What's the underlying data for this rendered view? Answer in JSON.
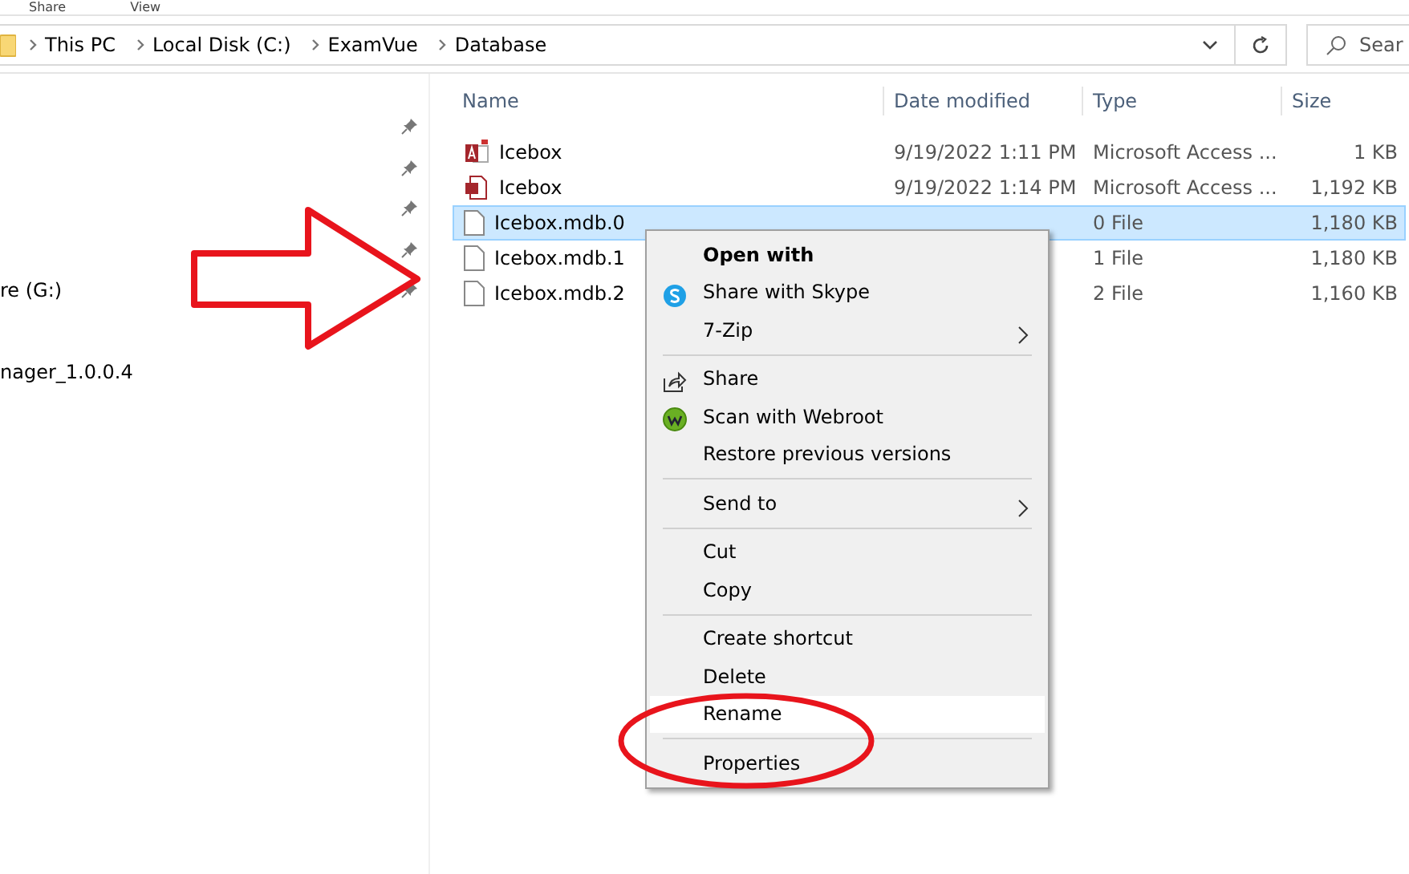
{
  "ribbon_tabs": [
    {
      "label": "Share"
    },
    {
      "label": "View"
    }
  ],
  "address_bar": {
    "breadcrumbs": [
      "This PC",
      "Local Disk (C:)",
      "ExamVue",
      "Database"
    ]
  },
  "search": {
    "placeholder": "Sear"
  },
  "sidebar": {
    "items": [
      {
        "pinned": true
      },
      {
        "pinned": true
      },
      {
        "pinned": true
      },
      {
        "pinned": true
      },
      {
        "label": "re (G:)",
        "pinned": true
      },
      {
        "label": "nager_1.0.0.4",
        "pinned": false
      }
    ]
  },
  "table": {
    "columns": [
      "Name",
      "Date modified",
      "Type",
      "Size"
    ],
    "rows": [
      {
        "kind": "access",
        "name": "Icebox",
        "date": "9/19/2022 1:11 PM",
        "type": "Microsoft Access ...",
        "size": "1 KB",
        "selected": false
      },
      {
        "kind": "report",
        "name": "Icebox",
        "date": "9/19/2022 1:14 PM",
        "type": "Microsoft Access ...",
        "size": "1,192 KB",
        "selected": false
      },
      {
        "kind": "file",
        "name": "Icebox.mdb.0",
        "type": "0 File",
        "size": "1,180 KB",
        "selected": true
      },
      {
        "kind": "file",
        "name": "Icebox.mdb.1",
        "type": "1 File",
        "size": "1,180 KB",
        "selected": false
      },
      {
        "kind": "file",
        "name": "Icebox.mdb.2",
        "type": "2 File",
        "size": "1,160 KB",
        "selected": false
      }
    ]
  },
  "context_menu": {
    "items": [
      {
        "kind": "plain",
        "label": "Open with",
        "bold": true,
        "submenu": false,
        "selected": false
      },
      {
        "kind": "skype",
        "label": "Share with Skype",
        "bold": false,
        "submenu": false,
        "selected": false
      },
      {
        "kind": "plain",
        "label": "7-Zip",
        "bold": false,
        "submenu": true,
        "selected": false
      },
      {
        "kind": "separator"
      },
      {
        "kind": "share",
        "label": "Share",
        "bold": false,
        "submenu": false,
        "selected": false
      },
      {
        "kind": "webroot",
        "label": "Scan with Webroot",
        "bold": false,
        "submenu": false,
        "selected": false
      },
      {
        "kind": "plain",
        "label": "Restore previous versions",
        "bold": false,
        "submenu": false,
        "selected": false
      },
      {
        "kind": "separator"
      },
      {
        "kind": "plain",
        "label": "Send to",
        "bold": false,
        "submenu": true,
        "selected": false
      },
      {
        "kind": "separator"
      },
      {
        "kind": "plain",
        "label": "Cut",
        "bold": false,
        "submenu": false,
        "selected": false
      },
      {
        "kind": "plain",
        "label": "Copy",
        "bold": false,
        "submenu": false,
        "selected": false
      },
      {
        "kind": "separator"
      },
      {
        "kind": "plain",
        "label": "Create shortcut",
        "bold": false,
        "submenu": false,
        "selected": false
      },
      {
        "kind": "plain",
        "label": "Delete",
        "bold": false,
        "submenu": false,
        "selected": false
      },
      {
        "kind": "plain",
        "label": "Rename",
        "bold": false,
        "submenu": false,
        "selected": true
      },
      {
        "kind": "separator"
      },
      {
        "kind": "plain",
        "label": "Properties",
        "bold": false,
        "submenu": false,
        "selected": false
      }
    ]
  }
}
